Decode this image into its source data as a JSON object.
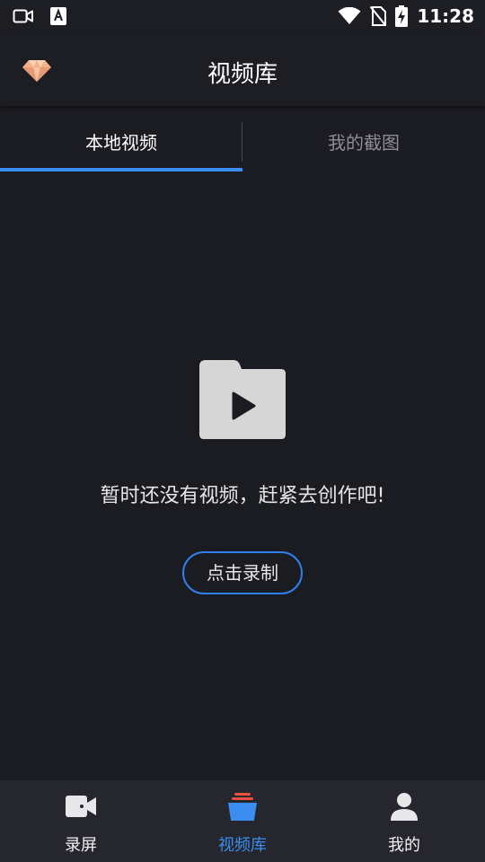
{
  "status_bar": {
    "time": "11:28",
    "icons": [
      "video-camera-icon",
      "a-notification-icon",
      "wifi-icon",
      "no-sim-icon",
      "battery-charging-icon"
    ]
  },
  "header": {
    "title": "视频库",
    "left_icon": "diamond-vip-icon"
  },
  "tabs": [
    {
      "label": "本地视频",
      "selected": true
    },
    {
      "label": "我的截图",
      "selected": false
    }
  ],
  "empty_state": {
    "icon": "folder-play-icon",
    "message": "暂时还没有视频，赶紧去创作吧!",
    "button_label": "点击录制"
  },
  "bottom_nav": [
    {
      "label": "录屏",
      "icon": "video-camera-icon",
      "active": false
    },
    {
      "label": "视频库",
      "icon": "video-library-icon",
      "active": true
    },
    {
      "label": "我的",
      "icon": "person-icon",
      "active": false
    }
  ],
  "colors": {
    "background": "#1b1c22",
    "accent": "#3b8ef0",
    "nav_background": "#25262e",
    "inactive_tab": "#8d8e94"
  }
}
